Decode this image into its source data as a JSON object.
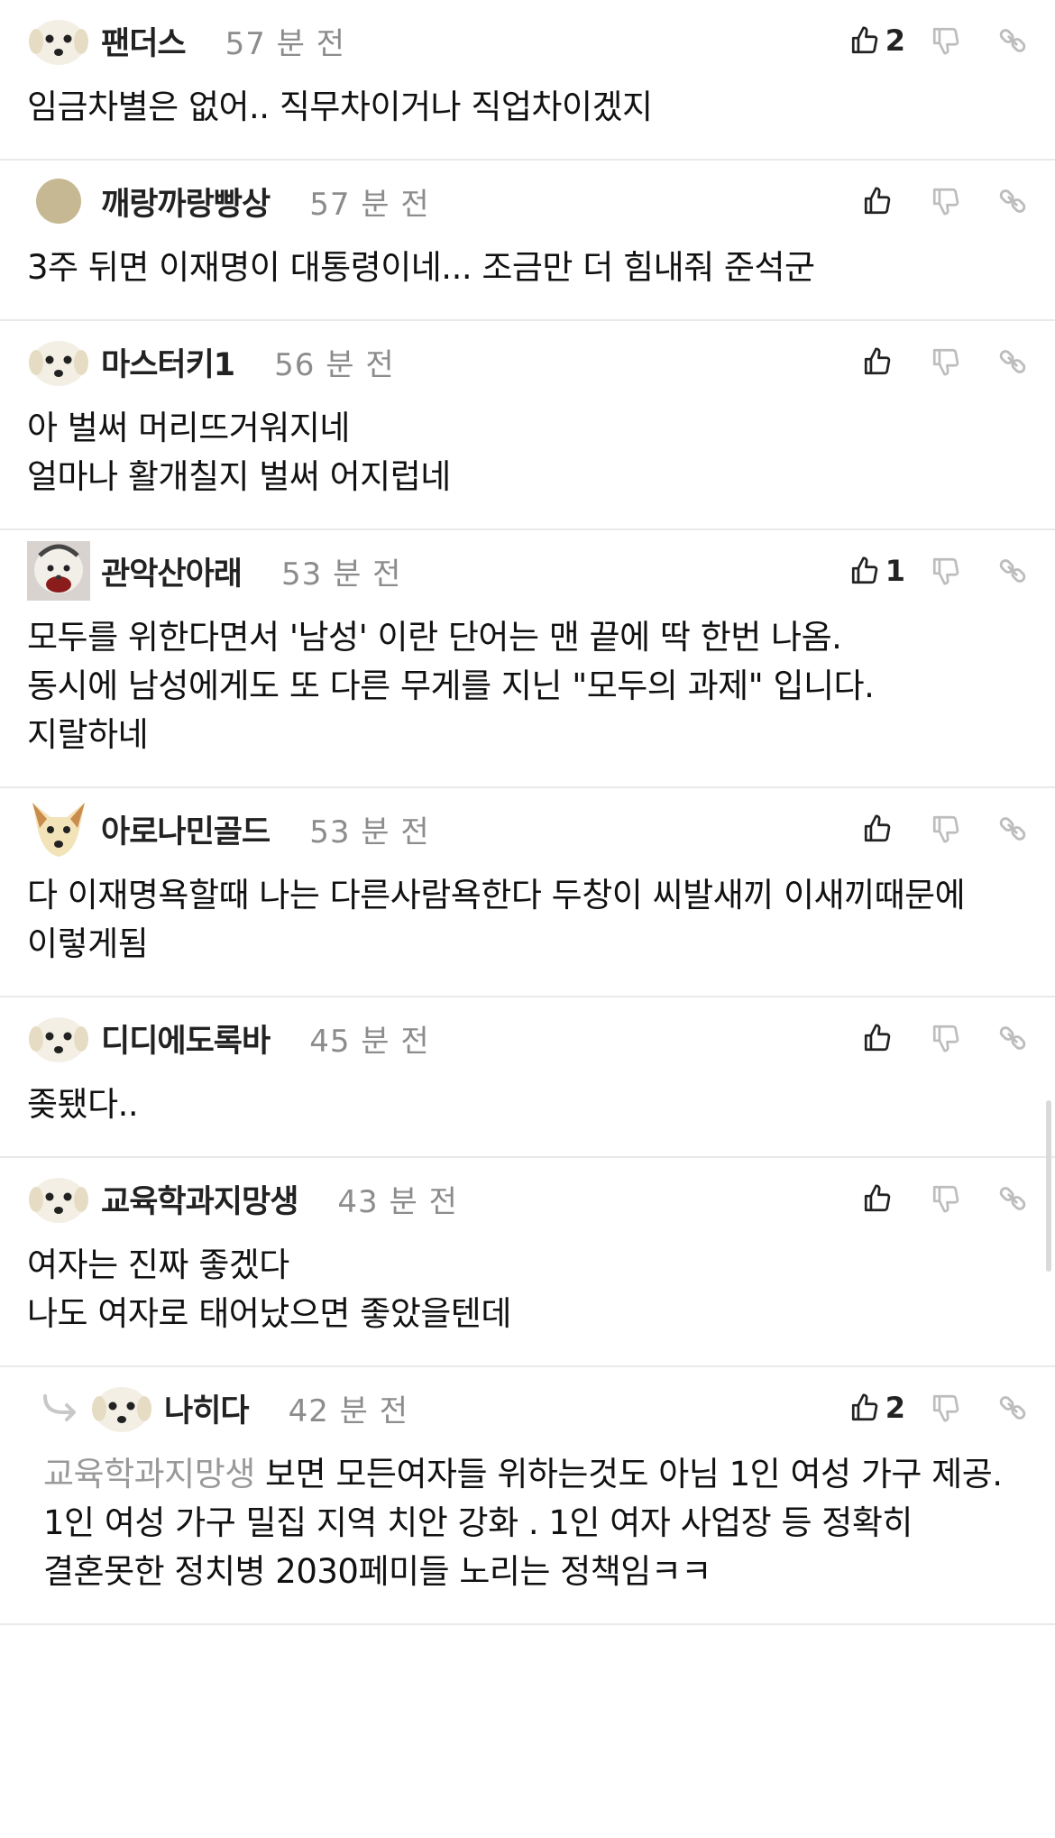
{
  "comments": [
    {
      "nick": "팬더스",
      "time": "57 분 전",
      "likes": "2",
      "avatar": "puppy",
      "body": "임금차별은 없어.. 직무차이거나 직업차이겠지"
    },
    {
      "nick": "깨랑까랑빵상",
      "time": "57 분 전",
      "likes": "",
      "avatar": "tan",
      "body": "3주 뒤면 이재명이 대통령이네... 조금만 더 힘내줘 준석군"
    },
    {
      "nick": "마스터키1",
      "time": "56 분 전",
      "likes": "",
      "avatar": "puppy",
      "body": "아 벌써 머리뜨거워지네\n얼마나 활개칠지 벌써 어지럽네"
    },
    {
      "nick": "관악산아래",
      "time": "53 분 전",
      "likes": "1",
      "avatar": "photo",
      "body": "모두를 위한다면서 '남성' 이란 단어는 맨 끝에 딱 한번 나옴.\n동시에 남성에게도 또 다른 무게를 지닌 \"모두의 과제\" 입니다.\n지랄하네"
    },
    {
      "nick": "아로나민골드",
      "time": "53 분 전",
      "likes": "",
      "avatar": "dog",
      "body": "다 이재명욕할때 나는 다른사람욕한다 두창이 씨발새끼 이새끼때문에 이렇게됨"
    },
    {
      "nick": "디디에도록바",
      "time": "45 분 전",
      "likes": "",
      "avatar": "puppy",
      "body": "좆됐다.."
    },
    {
      "nick": "교육학과지망생",
      "time": "43 분 전",
      "likes": "",
      "avatar": "puppy",
      "body": "여자는 진짜 좋겠다\n나도 여자로 태어났으면 좋았을텐데"
    }
  ],
  "reply": {
    "nick": "나히다",
    "time": "42 분 전",
    "likes": "2",
    "avatar": "puppy",
    "mention": "교육학과지망생",
    "body": " 보면 모든여자들 위하는것도 아님 1인 여성 가구 제공. 1인 여성 가구 밀집 지역 치안 강화 . 1인 여자 사업장 등 정확히 결혼못한 정치병 2030페미들 노리는 정책임ㅋㅋ"
  },
  "icons": {
    "like": "thumbs-up-icon",
    "dislike": "thumbs-down-icon",
    "link": "link-icon",
    "reply": "reply-arrow-icon"
  },
  "colors": {
    "text": "#111111",
    "muted": "#8c8c8c",
    "divider": "#e9e9e9",
    "mention": "#999999"
  }
}
